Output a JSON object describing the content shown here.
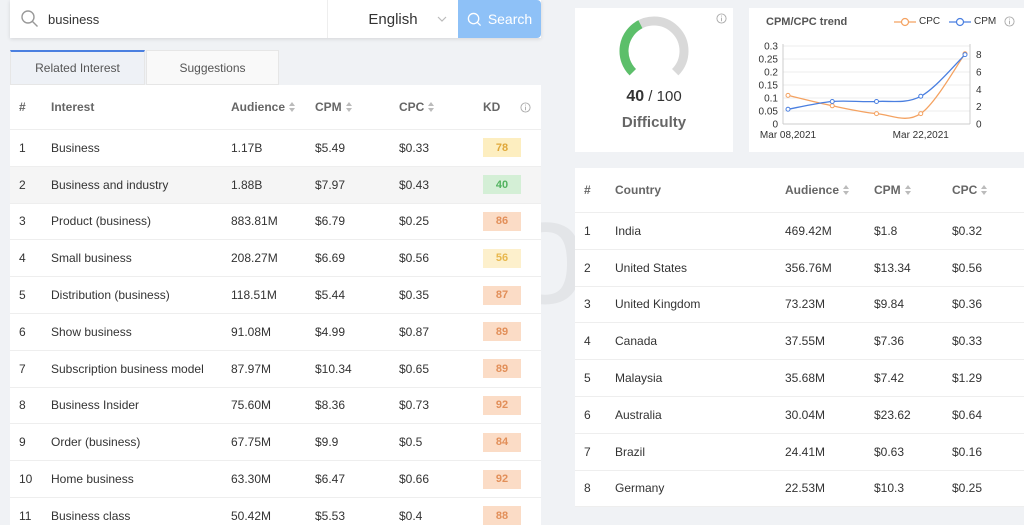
{
  "search": {
    "value": "business",
    "placeholder": ""
  },
  "language": {
    "selected": "English"
  },
  "search_button": {
    "label": "Search"
  },
  "tabs": [
    {
      "label": "Related Interest",
      "active": true
    },
    {
      "label": "Suggestions",
      "active": false
    }
  ],
  "interest_table": {
    "headers": [
      "#",
      "Interest",
      "Audience",
      "CPM",
      "CPC",
      "KD"
    ],
    "rows": [
      {
        "num": "1",
        "interest": "Business",
        "audience": "1.17B",
        "cpm": "$5.49",
        "cpc": "$0.33",
        "kd": "78",
        "kd_color": "#fdeec0",
        "kd_text": "#e0a83a"
      },
      {
        "num": "2",
        "interest": "Business and industry",
        "audience": "1.88B",
        "cpm": "$7.97",
        "cpc": "$0.43",
        "kd": "40",
        "kd_color": "#d4efd6",
        "kd_text": "#52b35f"
      },
      {
        "num": "3",
        "interest": "Product (business)",
        "audience": "883.81M",
        "cpm": "$6.79",
        "cpc": "$0.25",
        "kd": "86",
        "kd_color": "#fbdcc6",
        "kd_text": "#e28f59"
      },
      {
        "num": "4",
        "interest": "Small business",
        "audience": "208.27M",
        "cpm": "$6.69",
        "cpc": "$0.56",
        "kd": "56",
        "kd_color": "#fdf0cc",
        "kd_text": "#e8b74c"
      },
      {
        "num": "5",
        "interest": "Distribution (business)",
        "audience": "118.51M",
        "cpm": "$5.44",
        "cpc": "$0.35",
        "kd": "87",
        "kd_color": "#fbdcc6",
        "kd_text": "#e28f59"
      },
      {
        "num": "6",
        "interest": "Show business",
        "audience": "91.08M",
        "cpm": "$4.99",
        "cpc": "$0.87",
        "kd": "89",
        "kd_color": "#fbdcc6",
        "kd_text": "#e28f59"
      },
      {
        "num": "7",
        "interest": "Subscription business model",
        "audience": "87.97M",
        "cpm": "$10.34",
        "cpc": "$0.65",
        "kd": "89",
        "kd_color": "#fbdcc6",
        "kd_text": "#e28f59"
      },
      {
        "num": "8",
        "interest": "Business Insider",
        "audience": "75.60M",
        "cpm": "$8.36",
        "cpc": "$0.73",
        "kd": "92",
        "kd_color": "#fbdcc6",
        "kd_text": "#e28f59"
      },
      {
        "num": "9",
        "interest": "Order (business)",
        "audience": "67.75M",
        "cpm": "$9.9",
        "cpc": "$0.5",
        "kd": "84",
        "kd_color": "#fbdcc6",
        "kd_text": "#e28f59"
      },
      {
        "num": "10",
        "interest": "Home business",
        "audience": "63.30M",
        "cpm": "$6.47",
        "cpc": "$0.66",
        "kd": "92",
        "kd_color": "#fbdcc6",
        "kd_text": "#e28f59"
      },
      {
        "num": "11",
        "interest": "Business class",
        "audience": "50.42M",
        "cpm": "$5.53",
        "cpc": "$0.4",
        "kd": "88",
        "kd_color": "#fbdcc6",
        "kd_text": "#e28f59"
      }
    ]
  },
  "difficulty": {
    "score": "40",
    "max": "/ 100",
    "label": "Difficulty",
    "fraction": 0.4
  },
  "trend": {
    "title": "CPM/CPC trend",
    "legend_cpc": "CPC",
    "legend_cpm": "CPM",
    "cpc_color": "#f4a261",
    "cpm_color": "#4a7fe0"
  },
  "chart_data": {
    "type": "line",
    "title": "CPM/CPC trend",
    "x_tick_labels": [
      "Mar 08,2021",
      "Mar 22,2021"
    ],
    "x": [
      0,
      1,
      2,
      3,
      4
    ],
    "series": [
      {
        "name": "CPC",
        "axis": "left",
        "values": [
          0.11,
          0.07,
          0.04,
          0.04,
          0.27
        ]
      },
      {
        "name": "CPM",
        "axis": "right",
        "values": [
          1.7,
          2.6,
          2.6,
          3.2,
          8.0
        ]
      }
    ],
    "y_left_ticks": [
      "0",
      "0.05",
      "0.1",
      "0.15",
      "0.2",
      "0.25",
      "0.3"
    ],
    "y_left_lim": [
      0,
      0.3
    ],
    "y_right_ticks": [
      "0",
      "2",
      "4",
      "6",
      "8"
    ],
    "y_right_lim": [
      0,
      9
    ],
    "grid": true
  },
  "country_table": {
    "headers": [
      "#",
      "Country",
      "Audience",
      "CPM",
      "CPC"
    ],
    "rows": [
      {
        "num": "1",
        "country": "India",
        "audience": "469.42M",
        "cpm": "$1.8",
        "cpc": "$0.32"
      },
      {
        "num": "2",
        "country": "United States",
        "audience": "356.76M",
        "cpm": "$13.34",
        "cpc": "$0.56"
      },
      {
        "num": "3",
        "country": "United Kingdom",
        "audience": "73.23M",
        "cpm": "$9.84",
        "cpc": "$0.36"
      },
      {
        "num": "4",
        "country": "Canada",
        "audience": "37.55M",
        "cpm": "$7.36",
        "cpc": "$0.33"
      },
      {
        "num": "5",
        "country": "Malaysia",
        "audience": "35.68M",
        "cpm": "$7.42",
        "cpc": "$1.29"
      },
      {
        "num": "6",
        "country": "Australia",
        "audience": "30.04M",
        "cpm": "$23.62",
        "cpc": "$0.64"
      },
      {
        "num": "7",
        "country": "Brazil",
        "audience": "24.41M",
        "cpm": "$0.63",
        "cpc": "$0.16"
      },
      {
        "num": "8",
        "country": "Germany",
        "audience": "22.53M",
        "cpm": "$10.3",
        "cpc": "$0.25"
      }
    ]
  },
  "watermark": {
    "text": "ADCostly"
  }
}
